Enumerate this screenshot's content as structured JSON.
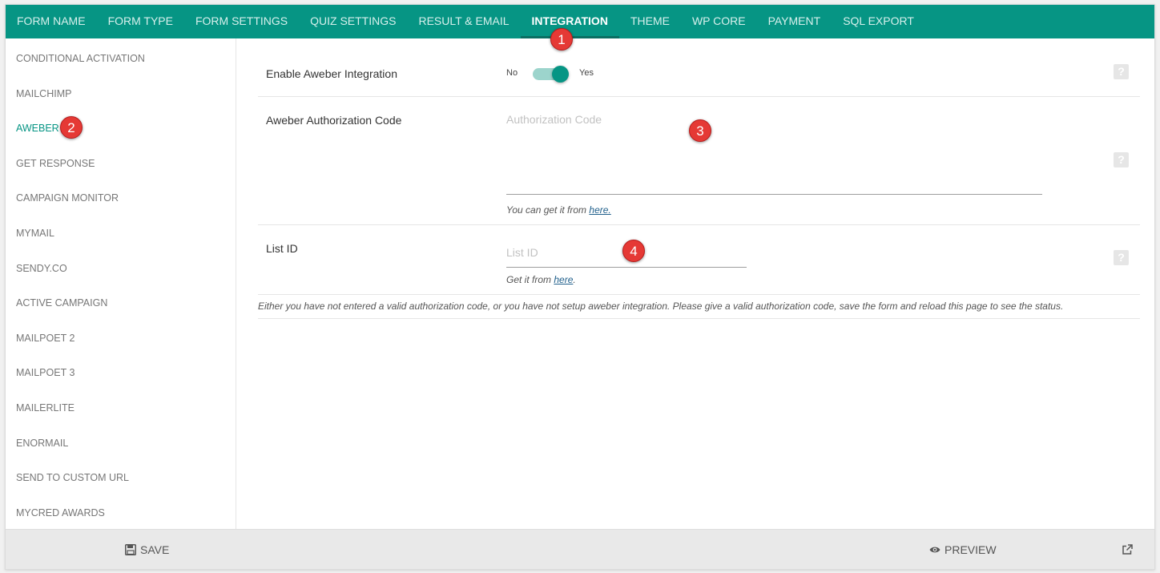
{
  "topnav": {
    "tabs": [
      {
        "label": "FORM NAME"
      },
      {
        "label": "FORM TYPE"
      },
      {
        "label": "FORM SETTINGS"
      },
      {
        "label": "QUIZ SETTINGS"
      },
      {
        "label": "RESULT & EMAIL"
      },
      {
        "label": "INTEGRATION",
        "active": true
      },
      {
        "label": "THEME"
      },
      {
        "label": "WP CORE"
      },
      {
        "label": "PAYMENT"
      },
      {
        "label": "SQL EXPORT"
      }
    ]
  },
  "sidebar": {
    "items": [
      {
        "label": "CONDITIONAL ACTIVATION"
      },
      {
        "label": "MAILCHIMP"
      },
      {
        "label": "AWEBER",
        "active": true
      },
      {
        "label": "GET RESPONSE"
      },
      {
        "label": "CAMPAIGN MONITOR"
      },
      {
        "label": "MYMAIL"
      },
      {
        "label": "SENDY.CO"
      },
      {
        "label": "ACTIVE CAMPAIGN"
      },
      {
        "label": "MAILPOET 2"
      },
      {
        "label": "MAILPOET 3"
      },
      {
        "label": "MAILERLITE"
      },
      {
        "label": "ENORMAIL"
      },
      {
        "label": "SEND TO CUSTOM URL"
      },
      {
        "label": "MYCRED AWARDS"
      }
    ]
  },
  "main": {
    "enable": {
      "label": "Enable Aweber Integration",
      "no": "No",
      "yes": "Yes",
      "enabled": true
    },
    "auth": {
      "label": "Aweber Authorization Code",
      "placeholder": "Authorization Code",
      "value": "",
      "hint_prefix": "You can get it from ",
      "hint_link": "here."
    },
    "list": {
      "label": "List ID",
      "placeholder": "List ID",
      "value": "",
      "hint_prefix": "Get it from ",
      "hint_link": "here",
      "hint_suffix": "."
    },
    "help_glyph": "?",
    "notice": "Either you have not entered a valid authorization code, or you have not setup aweber integration. Please give a valid authorization code, save the form and reload this page to see the status."
  },
  "markers": [
    "1",
    "2",
    "3",
    "4"
  ],
  "footer": {
    "save_label": "SAVE",
    "save_icon": "floppy-disk-icon",
    "preview_label": "PREVIEW",
    "preview_icon": "eye-icon",
    "external_icon": "external-link-icon"
  },
  "colors": {
    "accent": "#069584",
    "marker": "#e53935"
  }
}
